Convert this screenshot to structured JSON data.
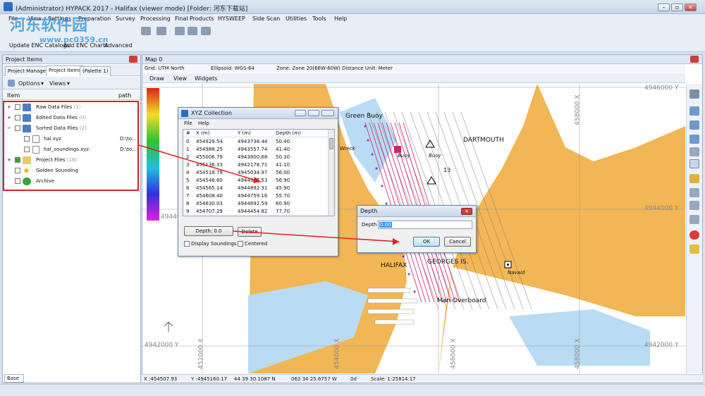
{
  "window": {
    "title": "(Administrator) HYPACK 2017 - Halifax (viewer mode)  [Folder: 河东下载站]",
    "minimize": "–",
    "maximize": "▫",
    "close": "✕"
  },
  "watermark": {
    "line1": "河东软件园",
    "line2": "www.pc0359.cn"
  },
  "menu": [
    "File",
    "View",
    "Settings",
    "Preparation",
    "Survey",
    "Processing",
    "Final Products",
    "HYSWEEP",
    "Side Scan",
    "Utilities",
    "Tools",
    "Help"
  ],
  "menu_bar2": [
    "Update ENC Catalogs",
    "Add ENC Charts",
    "Advanced"
  ],
  "project_items": {
    "title": "Project Items",
    "tabs": [
      "Project Manager",
      "Project Items",
      "(Palette 1)"
    ],
    "options_label": "Options",
    "views_label": "Views",
    "col_item": "Item",
    "col_path": "path",
    "tree": [
      {
        "label": "Raw Data Files",
        "count": "(1)",
        "path": ""
      },
      {
        "label": "Edited Data Files",
        "count": "(0)",
        "path": ""
      },
      {
        "label": "Sorted Data Files",
        "count": "(2)",
        "path": ""
      },
      {
        "label": "hal.xyz",
        "count": "",
        "path": "D:\\to..."
      },
      {
        "label": "hal_soundings.xyz",
        "count": "",
        "path": "D:\\to..."
      },
      {
        "label": "Project Files",
        "count": "(18)",
        "path": ""
      },
      {
        "label": "Golden Sounding",
        "count": "",
        "path": ""
      },
      {
        "label": "Archive",
        "count": "",
        "path": ""
      }
    ],
    "base_tab": "Base"
  },
  "map": {
    "title": "Map 0",
    "grid": "Grid: UTM North",
    "ellipsoid": "Ellipsoid: WGS-84",
    "zone": "Zone: Zone 20(66W-60W)",
    "distance": "Distance Unit: Meter",
    "draw_label": "Draw",
    "view_label": "View",
    "widgets_label": "Widgets",
    "grid_labels": {
      "y_top": "4946000 Y",
      "y_mid": "4944000 Y",
      "y_mid_left": "4944000",
      "y_bottom_left": "4942000 Y",
      "y_bottom_right": "4942000 Y",
      "x_top": "458000 X",
      "x_bottom_left": "452000 X",
      "x_bottom_mid": "454000 X",
      "x_bottom_right": "456000 X",
      "x_bottom_far": "458000 X"
    },
    "place_labels": [
      "Green Buoy",
      "DARTMOUTH",
      "HALIFAX",
      "GEORGES IS.",
      "Man Overboard",
      "Buoy",
      "Buoy",
      "Wreck",
      "Navaid"
    ],
    "depth_number": "13"
  },
  "status": {
    "x": "X :454507.93",
    "y": "Y :4945160.17",
    "lat": "44 39 30.1087 N",
    "lon": "063 34 25.6757 W",
    "heading": "0d",
    "scale": "Scale: 1:25814.17"
  },
  "xyz_dialog": {
    "title": "XYZ Collection",
    "menu": [
      "File",
      "Help"
    ],
    "headers": [
      "#",
      "X (m)",
      "Y (m)",
      "Depth (m)"
    ],
    "rows": [
      [
        "0",
        "454929.54",
        "4943738.44",
        "50.40"
      ],
      [
        "1",
        "454988.25",
        "4943557.74",
        "41.40"
      ],
      [
        "2",
        "455006.79",
        "4943800.68",
        "50.30"
      ],
      [
        "3",
        "455136.33",
        "4942178.71",
        "41.10"
      ],
      [
        "4",
        "454518.79",
        "4945034.97",
        "56.00"
      ],
      [
        "5",
        "454546.60",
        "4944947.53",
        "56.90"
      ],
      [
        "6",
        "454565.14",
        "4944892.31",
        "45.90"
      ],
      [
        "7",
        "454608.40",
        "4944759.16",
        "55.70"
      ],
      [
        "8",
        "454630.03",
        "4944692.59",
        "60.90"
      ],
      [
        "9",
        "454707.29",
        "4944454.82",
        "77.70"
      ]
    ],
    "depth_button": "Depth: 0.0",
    "delete_button": "Delete",
    "display_soundings": "Display Soundings",
    "centered": "Centered"
  },
  "depth_dialog": {
    "title": "Depth",
    "label": "Depth",
    "value": "0.00",
    "ok": "OK",
    "cancel": "Cancel"
  },
  "colors": {
    "land": "#f2b655",
    "water": "#ffffff",
    "shallow": "#b9dcf4",
    "annotation": "#e02020",
    "survey_lines": "#d0246a"
  }
}
